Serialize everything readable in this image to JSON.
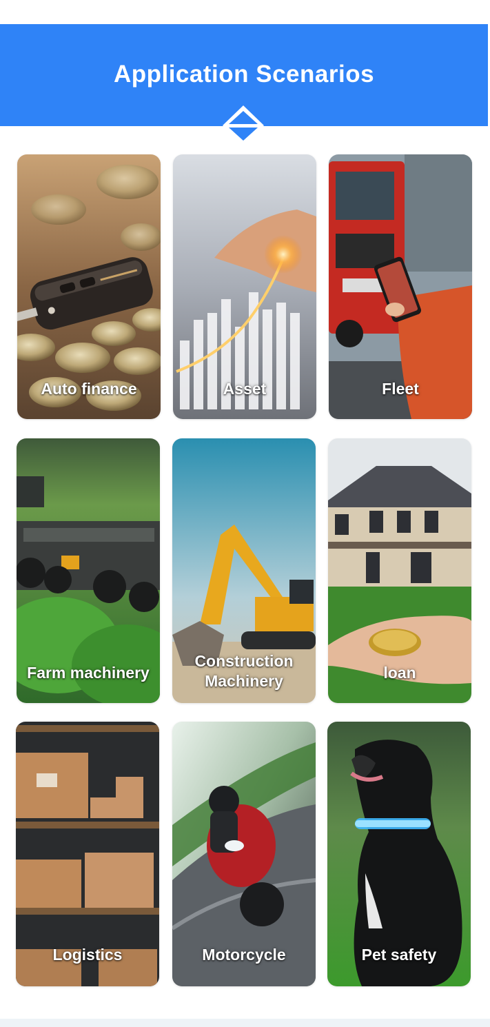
{
  "header": {
    "title": "Application Scenarios"
  },
  "colors": {
    "banner": "#2f83f7",
    "label_text": "#ffffff"
  },
  "scenarios": [
    {
      "label": "Auto finance",
      "icon": "car-key-coins-photo"
    },
    {
      "label": "Asset",
      "icon": "asset-chart-photo"
    },
    {
      "label": "Fleet",
      "icon": "truck-phone-photo"
    },
    {
      "label": "Farm machinery",
      "icon": "tractor-field-photo"
    },
    {
      "label": "Construction Machinery",
      "icon": "excavator-photo"
    },
    {
      "label": "loan",
      "icon": "house-coin-photo"
    },
    {
      "label": "Logistics",
      "icon": "warehouse-boxes-photo"
    },
    {
      "label": "Motorcycle",
      "icon": "motorcycle-photo"
    },
    {
      "label": "Pet safety",
      "icon": "dog-collar-photo"
    }
  ]
}
